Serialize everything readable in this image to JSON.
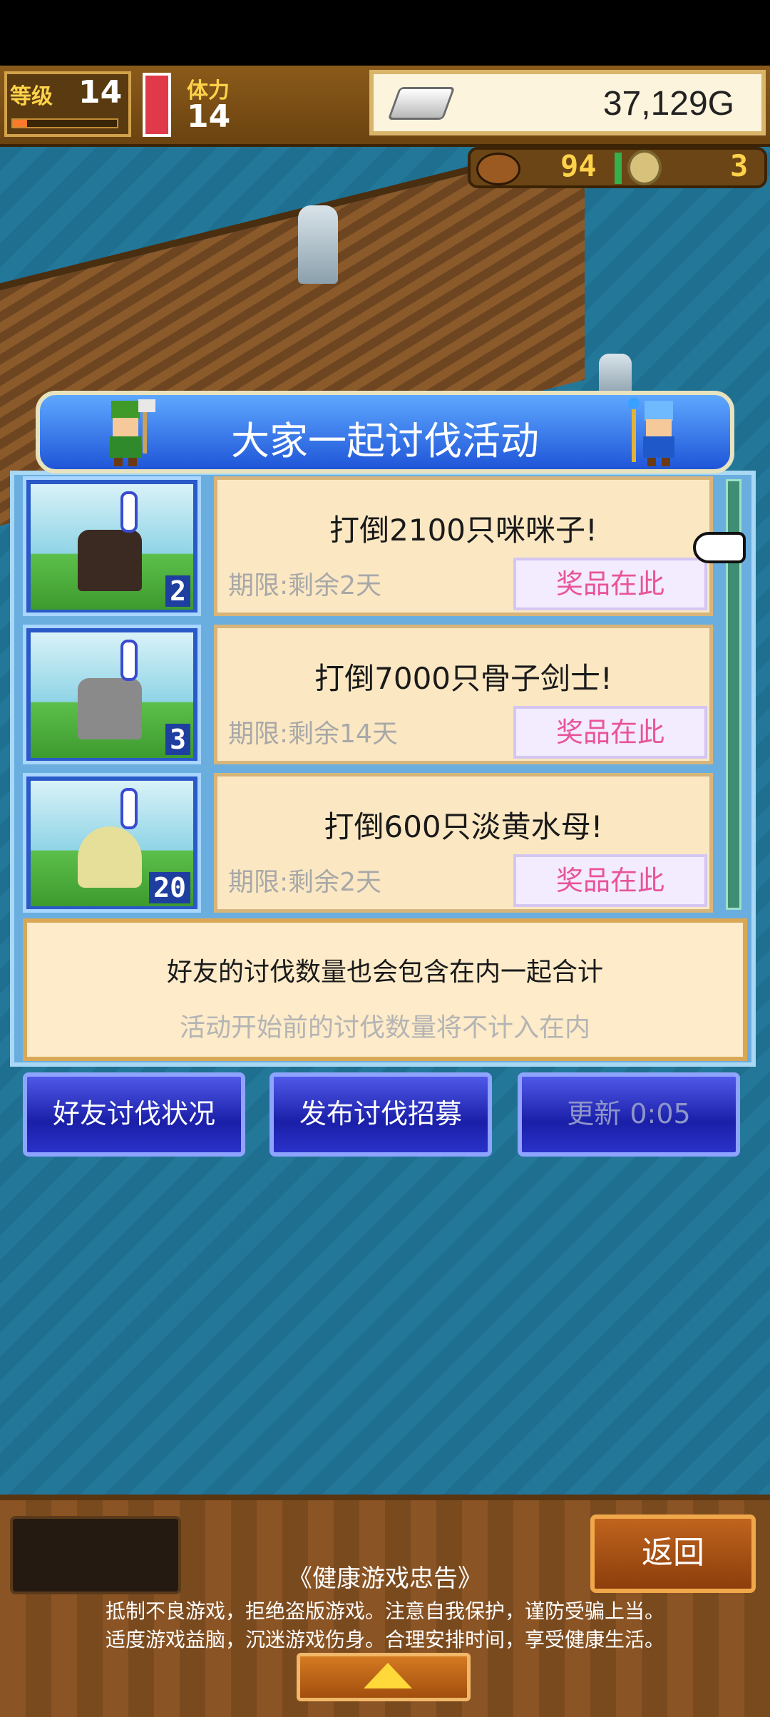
{
  "hud": {
    "level_label": "等级",
    "level_value": "14",
    "stamina_label": "体力",
    "stamina_value": "14",
    "gold_value": "37,129G",
    "food_value": "94",
    "medal_value": "3"
  },
  "dialog": {
    "title": "大家一起讨伐活动",
    "quests": [
      {
        "title": "打倒2100只咪咪子!",
        "deadline": "期限:剩余2天",
        "prize_label": "奖品在此",
        "count": "2",
        "monster_color": "#3a2a22"
      },
      {
        "title": "打倒7000只骨子剑士!",
        "deadline": "期限:剩余14天",
        "prize_label": "奖品在此",
        "count": "3",
        "monster_color": "#8a8a8a"
      },
      {
        "title": "打倒600只淡黄水母!",
        "deadline": "期限:剩余2天",
        "prize_label": "奖品在此",
        "count": "20",
        "monster_color": "#e6df9a"
      }
    ],
    "note_main": "好友的讨伐数量也会包含在内一起合计",
    "note_sub": "活动开始前的讨伐数量将不计入在内"
  },
  "buttons": {
    "friends": "好友讨伐状况",
    "recruit": "发布讨伐招募",
    "refresh": "更新 0:05"
  },
  "footer": {
    "back": "返回",
    "advisory_title": "《健康游戏忠告》",
    "advisory_line1": "抵制不良游戏，拒绝盗版游戏。注意自我保护，谨防受骗上当。",
    "advisory_line2": "适度游戏益脑，沉迷游戏伤身。合理安排时间，享受健康生活。"
  },
  "colors": {
    "prize_text": "#e8549a",
    "header_blue": "#1f55d8",
    "gold_text": "#ffd24a"
  }
}
